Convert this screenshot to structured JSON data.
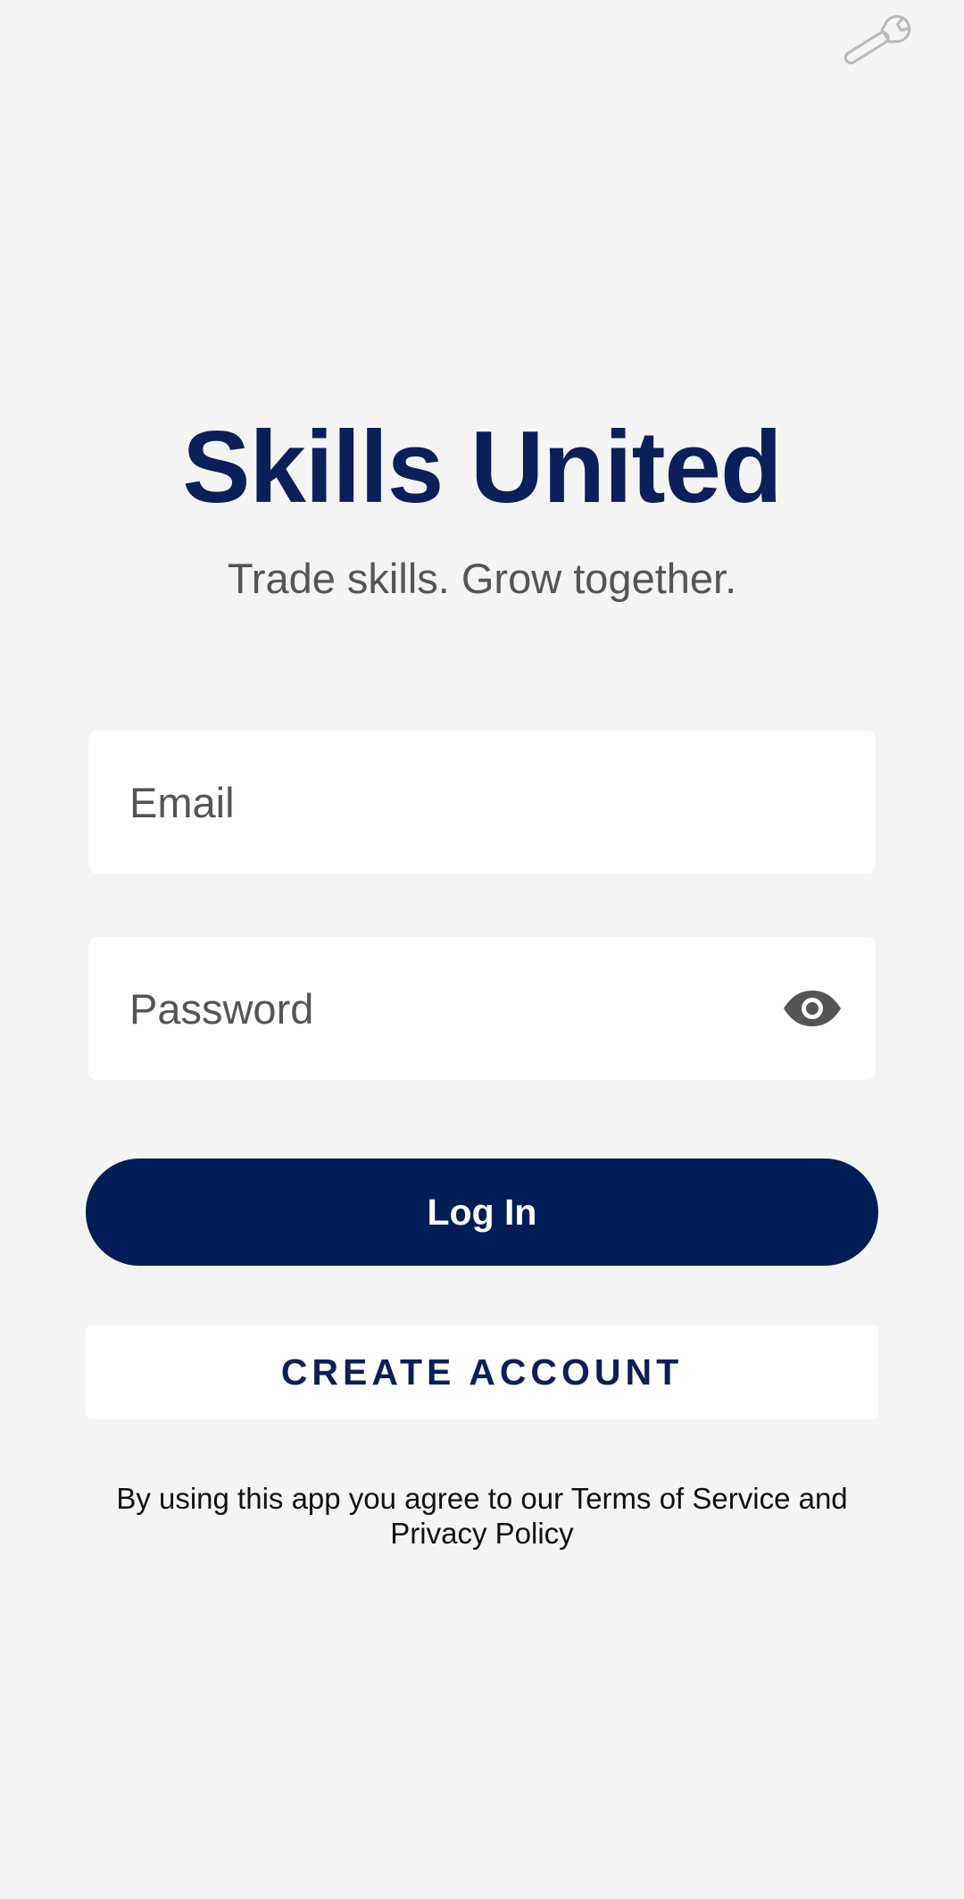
{
  "header": {
    "settings_icon": "wrench-icon"
  },
  "brand": {
    "title": "Skills United",
    "tagline": "Trade skills. Grow together.",
    "accent_color": "#001d57"
  },
  "form": {
    "email_placeholder": "Email",
    "password_placeholder": "Password",
    "password_toggle_icon": "eye-icon"
  },
  "actions": {
    "login_label": "Log In",
    "create_account_label": "CREATE ACCOUNT"
  },
  "footer": {
    "terms_text": "By using this app you agree to our Terms of Service and Privacy Policy"
  }
}
